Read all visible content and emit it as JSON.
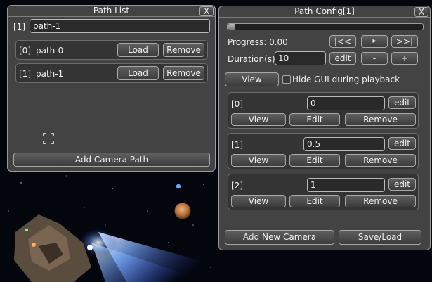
{
  "path_list": {
    "title": "Path List",
    "close_label": "X",
    "current_index": "[1]",
    "current_name": "path-1",
    "rows": [
      {
        "index": "[0]",
        "name": "path-0",
        "load_label": "Load",
        "remove_label": "Remove"
      },
      {
        "index": "[1]",
        "name": "path-1",
        "load_label": "Load",
        "remove_label": "Remove"
      }
    ],
    "add_label": "Add Camera Path"
  },
  "path_config": {
    "title": "Path Config[1]",
    "close_label": "X",
    "progress_label": "Progress: 0.00",
    "progress_fraction": 0.0,
    "rewind_label": "|<<",
    "play_label": "▸",
    "end_label": ">>|",
    "duration_label": "Duration(s)",
    "duration_value": "10",
    "edit_label": "edit",
    "minus_label": "-",
    "plus_label": "+",
    "view_label": "View",
    "hide_gui_label": "Hide GUI during playback",
    "hide_gui_checked": false,
    "cameras": [
      {
        "index": "[0]",
        "value": "0",
        "edit_label": "edit",
        "view_label": "View",
        "edit2_label": "Edit",
        "remove_label": "Remove"
      },
      {
        "index": "[1]",
        "value": "0.5",
        "edit_label": "edit",
        "view_label": "View",
        "edit2_label": "Edit",
        "remove_label": "Remove"
      },
      {
        "index": "[2]",
        "value": "1",
        "edit_label": "edit",
        "view_label": "View",
        "edit2_label": "Edit",
        "remove_label": "Remove"
      }
    ],
    "add_camera_label": "Add New Camera",
    "save_load_label": "Save/Load"
  }
}
